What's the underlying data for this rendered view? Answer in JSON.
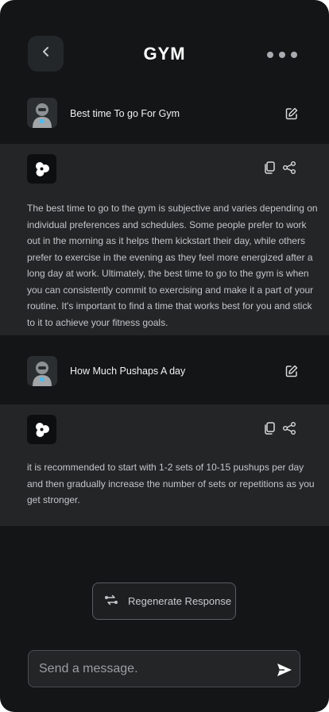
{
  "header": {
    "title": "GYM",
    "back_icon": "chevron-left-icon",
    "more_icon": "more-horizontal-icon"
  },
  "conversation": [
    {
      "question": "Best time To go For Gym",
      "answer": "The best time to go to the gym is subjective and varies depending on individual preferences and schedules. Some people prefer to work out in the morning as it helps them kickstart their day, while others prefer to exercise in the evening as they feel more energized after a long day at work. Ultimately, the best time to go to the gym is when you can consistently commit to exercising and make it a part of your routine. It's important to find a time that works best for you and stick to it to achieve your fitness goals."
    },
    {
      "question": "How Much Pushaps A day",
      "answer": "it is recommended to start with 1-2 sets of 10-15 pushups per day and then gradually increase the number of sets or repetitions as you get stronger."
    }
  ],
  "regenerate": {
    "label": "Regenerate Response",
    "icon": "refresh-icon"
  },
  "composer": {
    "placeholder": "Send a message.",
    "value": "",
    "send_icon": "send-icon"
  },
  "colors": {
    "background": "#131516",
    "answer_background": "#232526",
    "text_primary": "#ffffff",
    "text_secondary": "#c3c6c9"
  }
}
